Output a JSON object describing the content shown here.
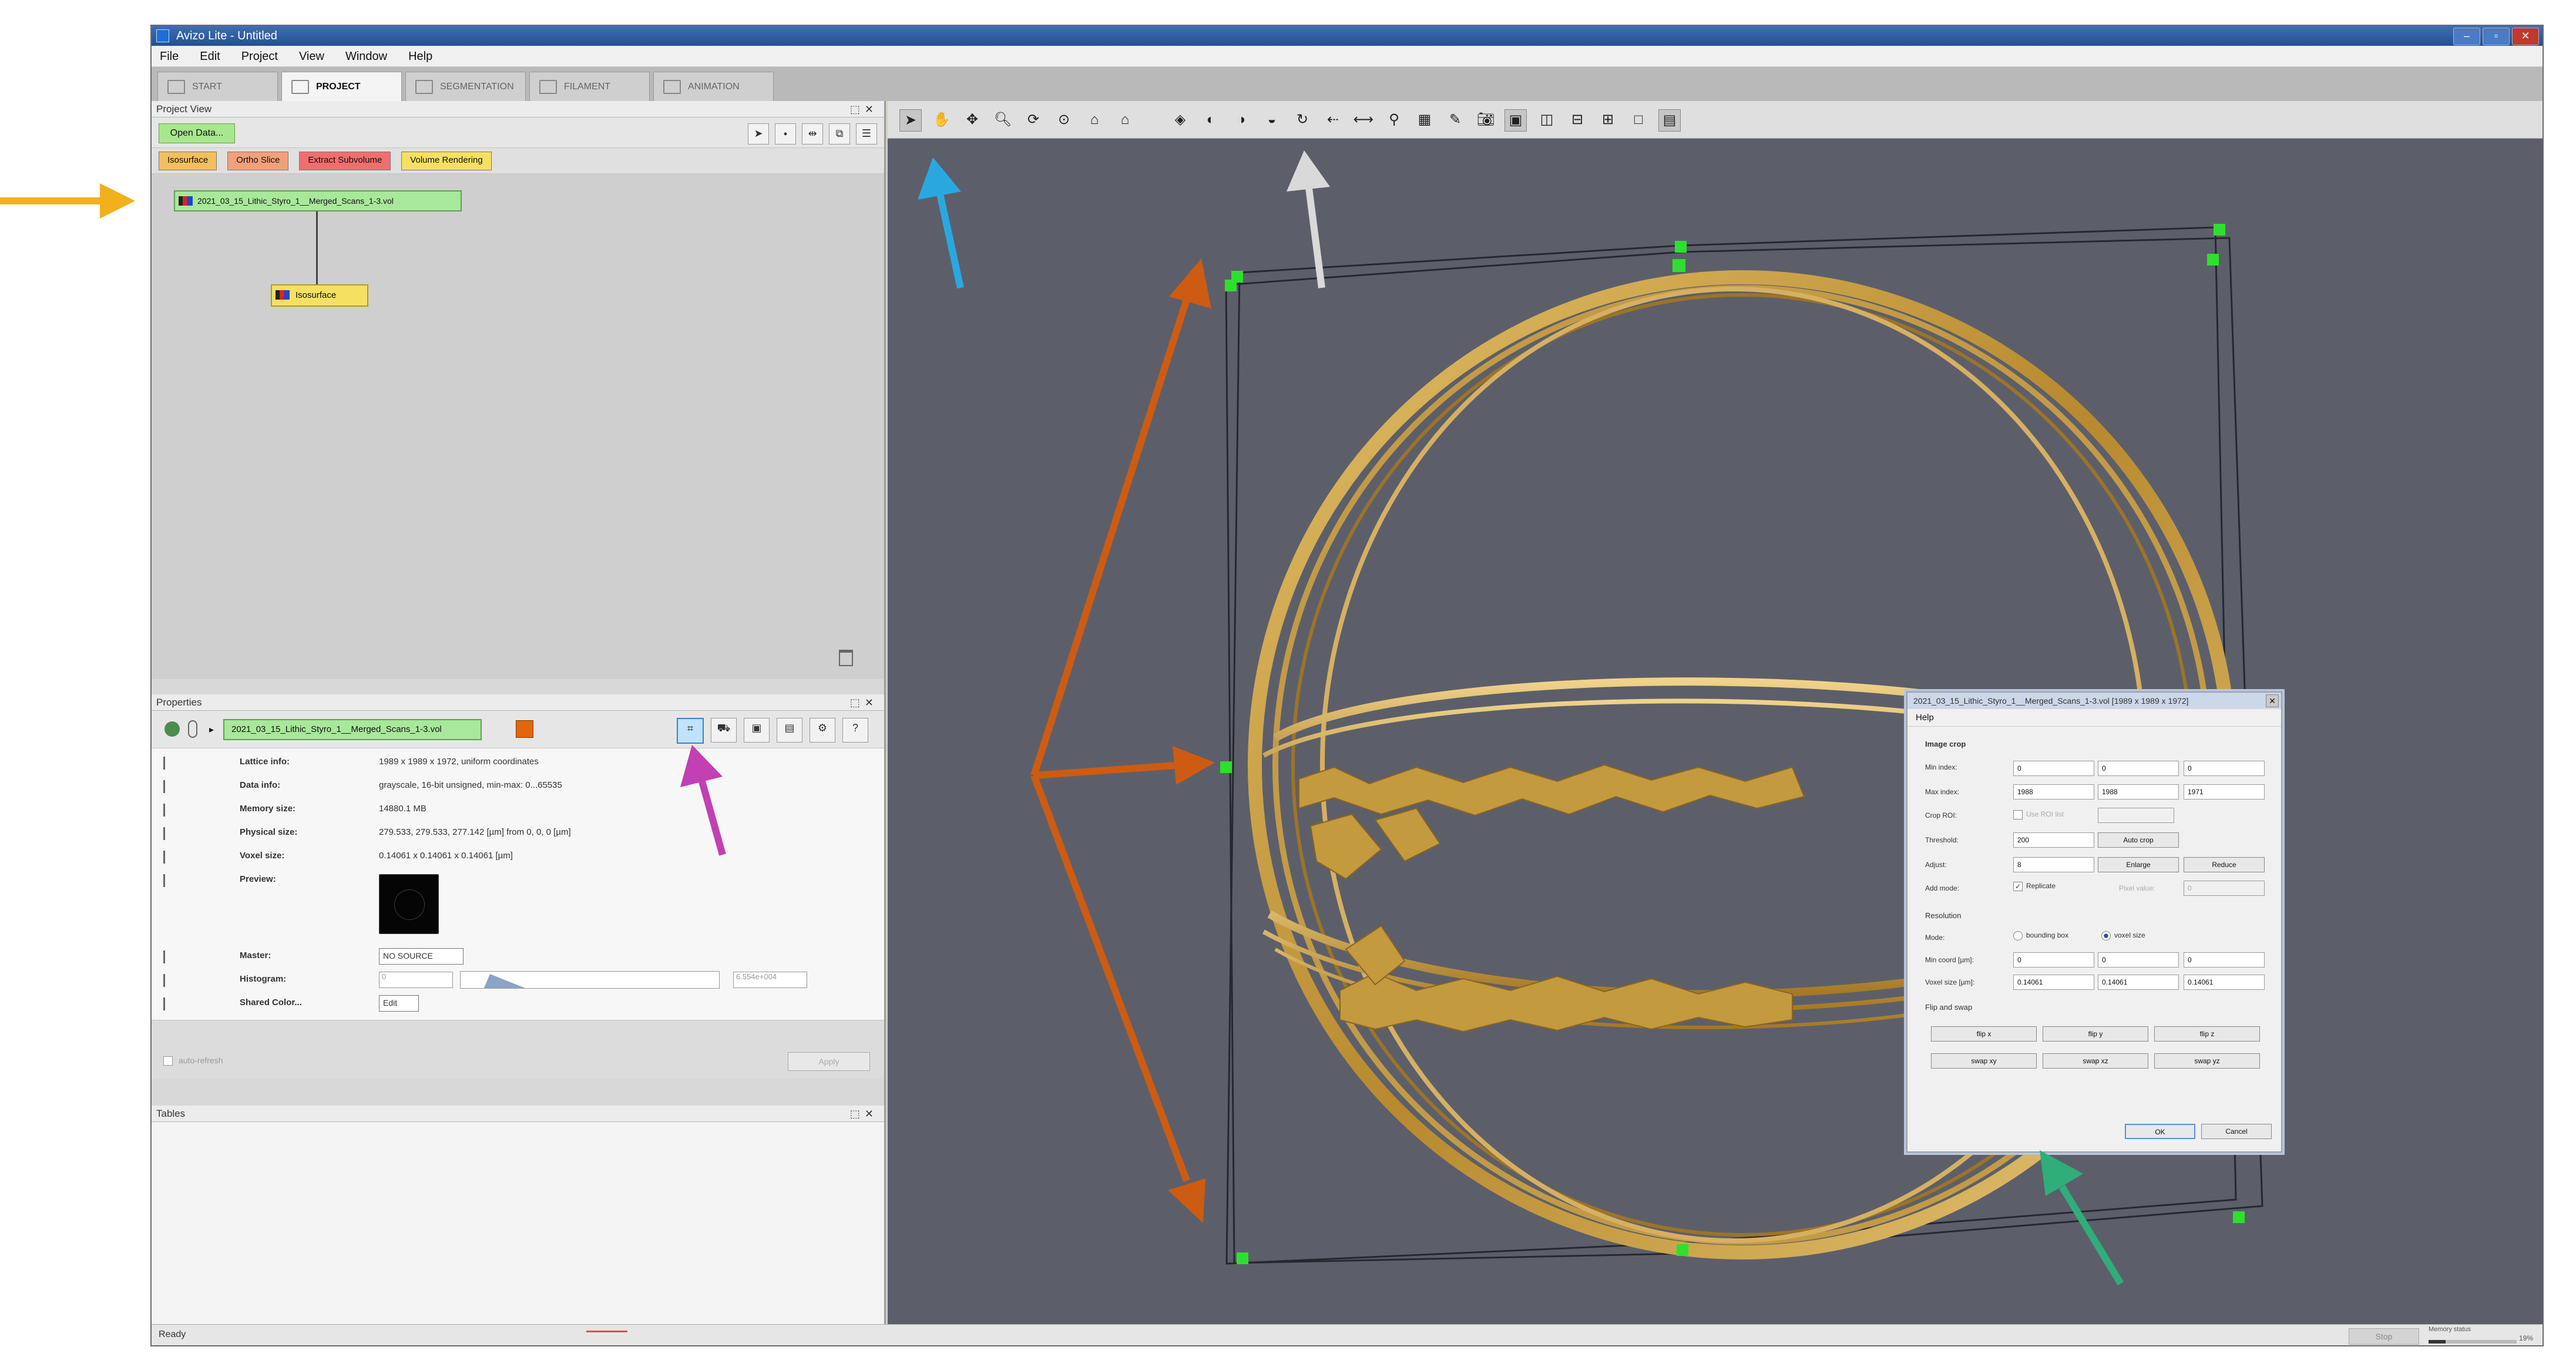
{
  "window": {
    "title": "Avizo Lite - Untitled"
  },
  "menu": [
    "File",
    "Edit",
    "Project",
    "View",
    "Window",
    "Help"
  ],
  "workroom_tabs": [
    "START",
    "PROJECT",
    "SEGMENTATION",
    "FILAMENT",
    "ANIMATION"
  ],
  "project_view": {
    "title": "Project View",
    "open_data_label": "Open Data...",
    "quick_buttons": [
      {
        "label": "Isosurface",
        "color": "#f2bf5e"
      },
      {
        "label": "Ortho Slice",
        "color": "#f2a07a"
      },
      {
        "label": "Extract Subvolume",
        "color": "#ef6f6f"
      },
      {
        "label": "Volume Rendering",
        "color": "#f5e061"
      }
    ],
    "data_node": "2021_03_15_Lithic_Styro_1__Merged_Scans_1-3.vol",
    "surface_node": "Isosurface"
  },
  "properties": {
    "title": "Properties",
    "node": "2021_03_15_Lithic_Styro_1__Merged_Scans_1-3.vol",
    "rows": [
      {
        "label": "Lattice info:",
        "value": "1989 x 1989 x 1972, uniform coordinates"
      },
      {
        "label": "Data info:",
        "value": "grayscale, 16-bit unsigned, min-max: 0...65535"
      },
      {
        "label": "Memory size:",
        "value": "14880.1 MB"
      },
      {
        "label": "Physical size:",
        "value": "279.533, 279.533, 277.142 [µm] from 0, 0, 0 [µm]"
      },
      {
        "label": "Voxel size:",
        "value": "0.14061 x 0.14061 x 0.14061 [µm]"
      },
      {
        "label": "Preview:",
        "value": ""
      }
    ],
    "master_label": "Master:",
    "master_value": "NO SOURCE",
    "histogram_label": "Histogram:",
    "histogram_min": "0",
    "histogram_max": "6.554e+004",
    "shared_color_label": "Shared Color...",
    "shared_color_value": "Edit",
    "auto_refresh_label": "auto-refresh",
    "apply_label": "Apply"
  },
  "tables": {
    "title": "Tables"
  },
  "status": {
    "text": "Ready",
    "stop_label": "Stop",
    "memory_label": "Memory status",
    "memory_percent": "19%",
    "memory_fraction": 0.19
  },
  "crop_dialog": {
    "title": "2021_03_15_Lithic_Styro_1__Merged_Scans_1-3.vol [1989 x 1989 x 1972]",
    "help_label": "Help",
    "image_crop_label": "Image crop",
    "min_index_label": "Min index:",
    "min_index": [
      "0",
      "0",
      "0"
    ],
    "max_index_label": "Max index:",
    "max_index": [
      "1988",
      "1988",
      "1971"
    ],
    "crop_roi_label": "Crop ROI:",
    "use_roi_label": "Use ROI list",
    "threshold_label": "Threshold:",
    "threshold_value": "200",
    "auto_crop_label": "Auto crop",
    "adjust_label": "Adjust:",
    "adjust_value": "8",
    "enlarge_label": "Enlarge",
    "reduce_label": "Reduce",
    "add_mode_label": "Add mode:",
    "replicate_label": "Replicate",
    "pixel_value_label": "Pixel value:",
    "pixel_value": "0",
    "resolution_label": "Resolution",
    "mode_label": "Mode:",
    "bounding_box_label": "bounding box",
    "voxel_size_label": "voxel size",
    "min_coord_label": "Min coord [µm]:",
    "min_coord": [
      "0",
      "0",
      "0"
    ],
    "voxel_size_field_label": "Voxel size [µm]:",
    "voxel_size": [
      "0.14061",
      "0.14061",
      "0.14061"
    ],
    "flip_swap_label": "Flip and swap",
    "flip": [
      "flip x",
      "flip y",
      "flip z"
    ],
    "swap": [
      "swap xy",
      "swap xz",
      "swap yz"
    ],
    "ok_label": "OK",
    "cancel_label": "Cancel"
  },
  "colors": {
    "viewer_bg": "#5c5f6a",
    "gold": "#c9a24a",
    "arrow_yellow": "#f2b01c",
    "arrow_blue": "#29a8e0",
    "arrow_white": "#d9d9d9",
    "arrow_magenta": "#c23fb4",
    "arrow_orange": "#cd5b12",
    "arrow_green": "#2fae7a"
  }
}
